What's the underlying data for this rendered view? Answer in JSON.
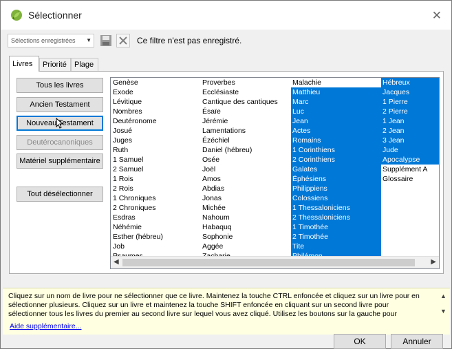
{
  "window": {
    "title": "Sélectionner"
  },
  "toolbar": {
    "saved_selections_value": "Sélections enregistrées",
    "status_text": "Ce filtre n'est pas enregistré."
  },
  "tabs": [
    {
      "label": "Livres",
      "active": true
    },
    {
      "label": "Priorité",
      "active": false
    },
    {
      "label": "Plage",
      "active": false
    }
  ],
  "buttons": {
    "all_books": "Tous les livres",
    "old_testament": "Ancien Testament",
    "new_testament": "Nouveau Testament",
    "deuterocanonical": "Deutérocanoniques",
    "supplementary": "Matériel supplémentaire",
    "deselect_all": "Tout désélectionner"
  },
  "books": {
    "col1": [
      {
        "name": "Genèse",
        "selected": false
      },
      {
        "name": "Exode",
        "selected": false
      },
      {
        "name": "Lévitique",
        "selected": false
      },
      {
        "name": "Nombres",
        "selected": false
      },
      {
        "name": "Deutéronome",
        "selected": false
      },
      {
        "name": "Josué",
        "selected": false
      },
      {
        "name": "Juges",
        "selected": false
      },
      {
        "name": "Ruth",
        "selected": false
      },
      {
        "name": "1 Samuel",
        "selected": false
      },
      {
        "name": "2 Samuel",
        "selected": false
      },
      {
        "name": "1 Rois",
        "selected": false
      },
      {
        "name": "2 Rois",
        "selected": false
      },
      {
        "name": "1 Chroniques",
        "selected": false
      },
      {
        "name": "2 Chroniques",
        "selected": false
      },
      {
        "name": "Esdras",
        "selected": false
      },
      {
        "name": "Néhémie",
        "selected": false
      },
      {
        "name": "Esther (hébreu)",
        "selected": false
      },
      {
        "name": "Job",
        "selected": false
      },
      {
        "name": "Psaumes",
        "selected": false
      }
    ],
    "col2": [
      {
        "name": "Proverbes",
        "selected": false
      },
      {
        "name": "Ecclésiaste",
        "selected": false
      },
      {
        "name": "Cantique des cantiques",
        "selected": false
      },
      {
        "name": "Ésaïe",
        "selected": false
      },
      {
        "name": "Jérémie",
        "selected": false
      },
      {
        "name": "Lamentations",
        "selected": false
      },
      {
        "name": "Ézéchiel",
        "selected": false
      },
      {
        "name": "Daniel (hébreu)",
        "selected": false
      },
      {
        "name": "Osée",
        "selected": false
      },
      {
        "name": "Joël",
        "selected": false
      },
      {
        "name": "Amos",
        "selected": false
      },
      {
        "name": "Abdias",
        "selected": false
      },
      {
        "name": "Jonas",
        "selected": false
      },
      {
        "name": "Michée",
        "selected": false
      },
      {
        "name": "Nahoum",
        "selected": false
      },
      {
        "name": "Habaquq",
        "selected": false
      },
      {
        "name": "Sophonie",
        "selected": false
      },
      {
        "name": "Aggée",
        "selected": false
      },
      {
        "name": "Zacharie",
        "selected": false
      }
    ],
    "col3": [
      {
        "name": "Malachie",
        "selected": false
      },
      {
        "name": "Matthieu",
        "selected": true
      },
      {
        "name": "Marc",
        "selected": true
      },
      {
        "name": "Luc",
        "selected": true
      },
      {
        "name": "Jean",
        "selected": true
      },
      {
        "name": "Actes",
        "selected": true
      },
      {
        "name": "Romains",
        "selected": true
      },
      {
        "name": "1 Corinthiens",
        "selected": true
      },
      {
        "name": "2 Corinthiens",
        "selected": true
      },
      {
        "name": "Galates",
        "selected": true
      },
      {
        "name": "Éphésiens",
        "selected": true
      },
      {
        "name": "Philippiens",
        "selected": true
      },
      {
        "name": "Colossiens",
        "selected": true
      },
      {
        "name": "1 Thessaloniciens",
        "selected": true
      },
      {
        "name": "2 Thessaloniciens",
        "selected": true
      },
      {
        "name": "1 Timothée",
        "selected": true
      },
      {
        "name": "2 Timothée",
        "selected": true
      },
      {
        "name": "Tite",
        "selected": true
      },
      {
        "name": "Philémon",
        "selected": true
      }
    ],
    "col4": [
      {
        "name": "Hébreux",
        "selected": true
      },
      {
        "name": "Jacques",
        "selected": true
      },
      {
        "name": "1 Pierre",
        "selected": true
      },
      {
        "name": "2 Pierre",
        "selected": true
      },
      {
        "name": "1 Jean",
        "selected": true
      },
      {
        "name": "2 Jean",
        "selected": true
      },
      {
        "name": "3 Jean",
        "selected": true
      },
      {
        "name": "Jude",
        "selected": true
      },
      {
        "name": "Apocalypse",
        "selected": true
      },
      {
        "name": "Supplément A",
        "selected": false
      },
      {
        "name": "Glossaire",
        "selected": false
      }
    ]
  },
  "help": {
    "text": "Cliquez sur un nom de livre pour ne sélectionner que ce livre. Maintenez la touche CTRL enfoncée et cliquez sur un livre pour en sélectionner plusieurs. Cliquez sur un livre et maintenez la touche SHIFT enfoncée en cliquant sur un second livre pour sélectionner tous les livres du premier au second livre sur lequel vous avez cliqué. Utilisez les boutons sur la gauche pour",
    "link": "Aide supplémentaire..."
  },
  "dialog": {
    "ok": "OK",
    "cancel": "Annuler"
  },
  "colors": {
    "selection": "#0078d7",
    "help_bg": "#ffffe1",
    "link": "#0000ee"
  },
  "icons": [
    "leaf-icon",
    "close-icon",
    "save-icon",
    "delete-icon",
    "cursor-icon"
  ]
}
